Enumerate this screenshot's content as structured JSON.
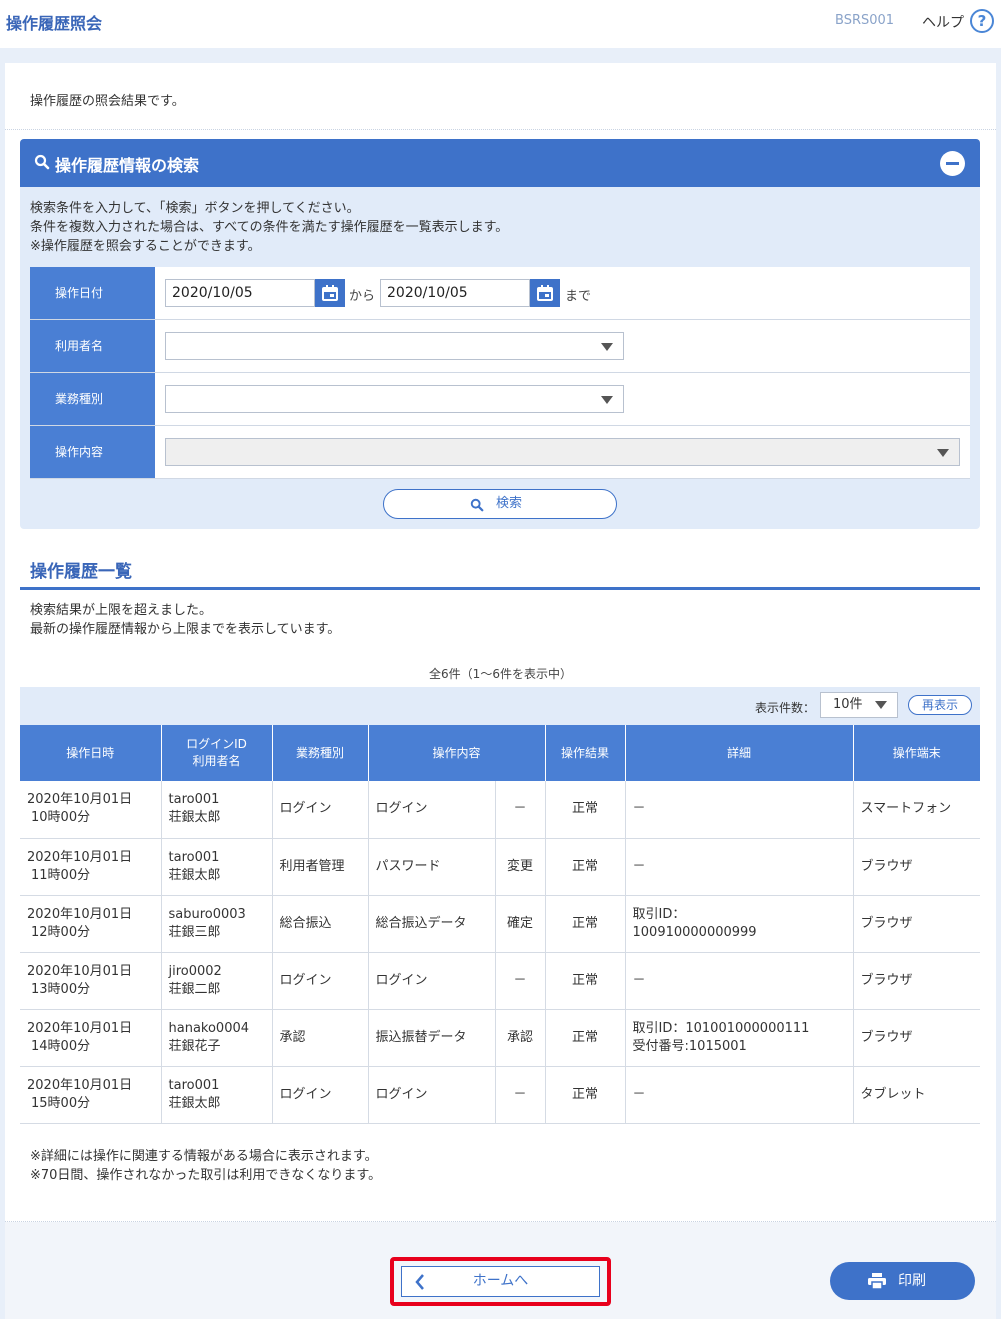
{
  "header": {
    "title": "操作履歴照会",
    "screen_id": "BSRS001",
    "help_label": "ヘルプ",
    "help_icon_glyph": "?"
  },
  "intro": "操作履歴の照会結果です。",
  "search": {
    "title": "操作履歴情報の検索",
    "desc_lines": [
      "検索条件を入力して、「検索」ボタンを押してください。",
      "条件を複数入力された場合は、すべての条件を満たす操作履歴を一覧表示します。",
      "※操作履歴を照会することができます。"
    ],
    "fields": {
      "date_label": "操作日付",
      "date_from": "2020/10/05",
      "date_sep": "から",
      "date_to": "2020/10/05",
      "date_end": "まで",
      "user_label": "利用者名",
      "business_label": "業務種別",
      "operation_label": "操作内容"
    },
    "button_label": "検索"
  },
  "list": {
    "title": "操作履歴一覧",
    "msg_lines": [
      "検索結果が上限を超えました。",
      "最新の操作履歴情報から上限までを表示しています。"
    ],
    "count_text": "全6件（1～6件を表示中）",
    "per_page_label": "表示件数：",
    "per_page_value": "10件",
    "redisplay_label": "再表示",
    "headers": {
      "datetime": "操作日時",
      "login_id": "ログインID",
      "user_name": "利用者名",
      "business": "業務種別",
      "operation": "操作内容",
      "result": "操作結果",
      "detail": "詳細",
      "terminal": "操作端末"
    },
    "rows": [
      {
        "date": "2020年10月01日",
        "time": "10時00分",
        "login_id": "taro001",
        "user": "荘銀太郎",
        "business": "ログイン",
        "op": "ログイン",
        "op_sub": "－",
        "result": "正常",
        "detail1": "－",
        "detail2": "",
        "terminal": "スマートフォン"
      },
      {
        "date": "2020年10月01日",
        "time": "11時00分",
        "login_id": "taro001",
        "user": "荘銀太郎",
        "business": "利用者管理",
        "op": "パスワード",
        "op_sub": "変更",
        "result": "正常",
        "detail1": "－",
        "detail2": "",
        "terminal": "ブラウザ"
      },
      {
        "date": "2020年10月01日",
        "time": "12時00分",
        "login_id": "saburo0003",
        "user": "荘銀三郎",
        "business": "総合振込",
        "op": "総合振込データ",
        "op_sub": "確定",
        "result": "正常",
        "detail1": "取引ID：",
        "detail2": "100910000000999",
        "terminal": "ブラウザ"
      },
      {
        "date": "2020年10月01日",
        "time": "13時00分",
        "login_id": "jiro0002",
        "user": "荘銀二郎",
        "business": "ログイン",
        "op": "ログイン",
        "op_sub": "－",
        "result": "正常",
        "detail1": "－",
        "detail2": "",
        "terminal": "ブラウザ"
      },
      {
        "date": "2020年10月01日",
        "time": "14時00分",
        "login_id": "hanako0004",
        "user": "荘銀花子",
        "business": "承認",
        "op": "振込振替データ",
        "op_sub": "承認",
        "result": "正常",
        "detail1": "取引ID：101001000000111",
        "detail2": "受付番号:1015001",
        "terminal": "ブラウザ"
      },
      {
        "date": "2020年10月01日",
        "time": "15時00分",
        "login_id": "taro001",
        "user": "荘銀太郎",
        "business": "ログイン",
        "op": "ログイン",
        "op_sub": "－",
        "result": "正常",
        "detail1": "－",
        "detail2": "",
        "terminal": "タブレット"
      }
    ],
    "notes": [
      "※詳細には操作に関連する情報がある場合に表示されます。",
      "※70日間、操作されなかった取引は利用できなくなります。"
    ]
  },
  "footer": {
    "home_label": "ホームへ",
    "print_label": "印刷"
  },
  "colors": {
    "accent": "#3e72c9",
    "header_cell": "#4a7fd4",
    "panel_bg": "#e1ebf9",
    "highlight": "#e8001c"
  },
  "icons": [
    "help-icon",
    "search-icon",
    "collapse-icon",
    "calendar-icon",
    "dropdown-arrow-icon",
    "chevron-left-icon",
    "printer-icon"
  ]
}
